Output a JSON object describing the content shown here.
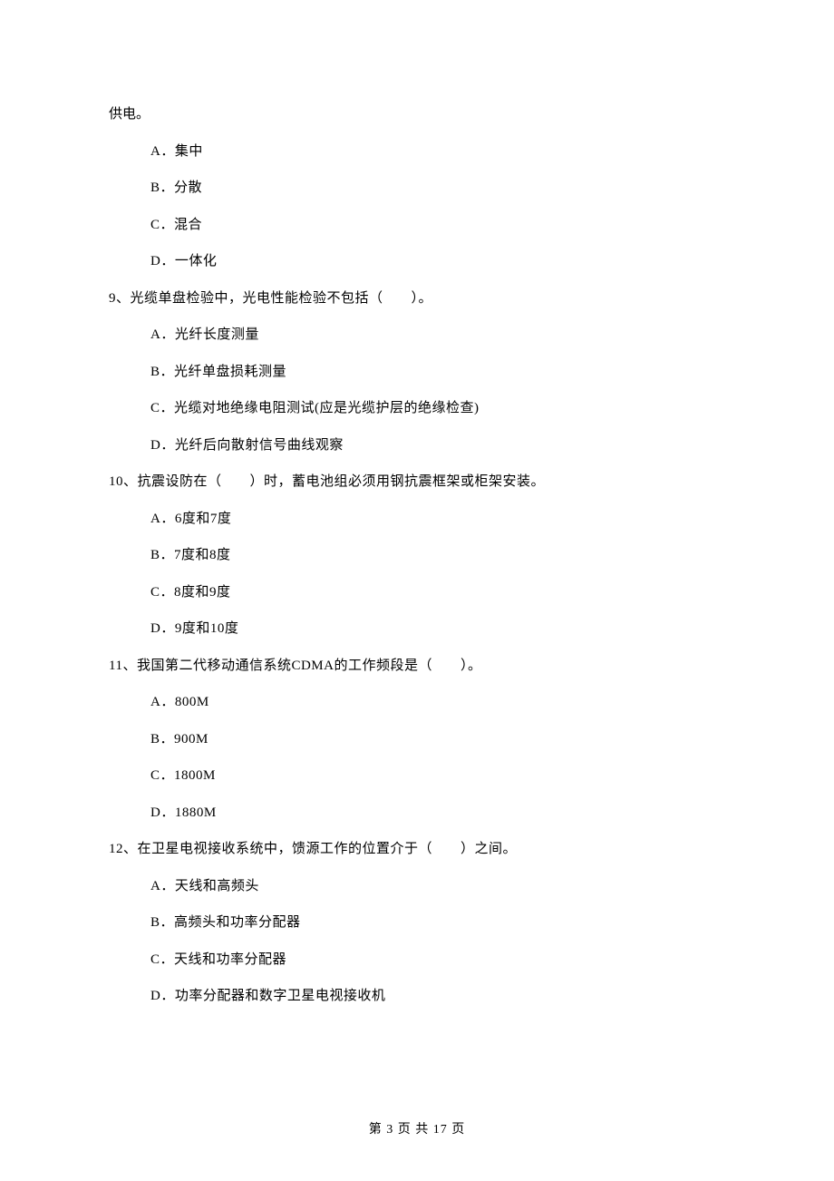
{
  "continuation": "供电。",
  "q8": {
    "options": {
      "a": "A．集中",
      "b": "B．分散",
      "c": "C．混合",
      "d": "D．一体化"
    }
  },
  "q9": {
    "stem": "9、光缆单盘检验中，光电性能检验不包括（　　）。",
    "options": {
      "a": "A．光纤长度测量",
      "b": "B．光纤单盘损耗测量",
      "c": "C．光缆对地绝缘电阻测试(应是光缆护层的绝缘检查)",
      "d": "D．光纤后向散射信号曲线观察"
    }
  },
  "q10": {
    "stem": "10、抗震设防在（　　）时，蓄电池组必须用钢抗震框架或柜架安装。",
    "options": {
      "a": "A．6度和7度",
      "b": "B．7度和8度",
      "c": "C．8度和9度",
      "d": "D．9度和10度"
    }
  },
  "q11": {
    "stem": "11、我国第二代移动通信系统CDMA的工作频段是（　　）。",
    "options": {
      "a": "A．800M",
      "b": "B．900M",
      "c": "C．1800M",
      "d": "D．1880M"
    }
  },
  "q12": {
    "stem": "12、在卫星电视接收系统中，馈源工作的位置介于（　　）之间。",
    "options": {
      "a": "A．天线和高频头",
      "b": "B．高频头和功率分配器",
      "c": "C．天线和功率分配器",
      "d": "D．功率分配器和数字卫星电视接收机"
    }
  },
  "footer": "第 3 页 共 17 页"
}
